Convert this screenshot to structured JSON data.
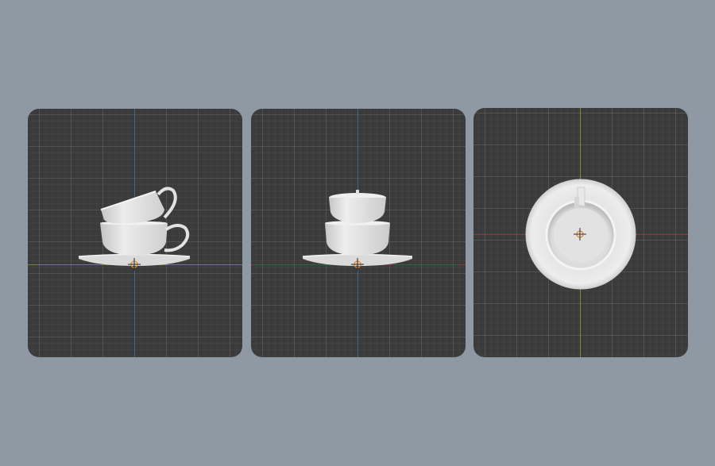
{
  "viewports": [
    {
      "view": "front",
      "axis_vertical_color": "#3f6b9a",
      "axis_horizontal_color": "#7d9b3a"
    },
    {
      "view": "side",
      "axis_vertical_color": "#3f6b9a",
      "axis_horizontal_color": "#9a3a47"
    },
    {
      "view": "top",
      "axis_vertical_color": "#8a9a2f",
      "axis_horizontal_color": "#9a3a47"
    }
  ],
  "colors": {
    "background": "#8e99a4",
    "viewport_bg": "#3b3b3b",
    "porcelain_light": "#e8e8e8",
    "porcelain_mid": "#d6d6d6",
    "porcelain_shadow": "#b9b9b9",
    "origin_marker": "#e28a2b"
  },
  "objects": {
    "items": [
      "teacup-upper",
      "teacup-lower",
      "saucer"
    ],
    "icons": [
      "origin-cursor-icon"
    ]
  }
}
